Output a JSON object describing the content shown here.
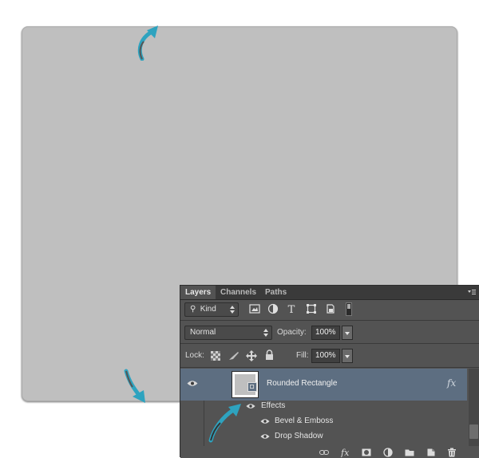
{
  "canvas": {
    "fill_color": "#bfbfbf"
  },
  "annotations": {
    "arrow_color": "#2ea3bf"
  },
  "panel": {
    "tabs": [
      {
        "label": "Layers",
        "active": true
      },
      {
        "label": "Channels",
        "active": false
      },
      {
        "label": "Paths",
        "active": false
      }
    ],
    "filter": {
      "label": "Kind"
    },
    "filter_icons": [
      "image-filter-icon",
      "adjustment-filter-icon",
      "type-filter-icon",
      "shape-filter-icon",
      "smart-object-filter-icon",
      "filter-toggle-icon"
    ],
    "blend_mode": "Normal",
    "opacity": {
      "label": "Opacity:",
      "value": "100%"
    },
    "lock": {
      "label": "Lock:",
      "icons": [
        "lock-transparent-icon",
        "lock-paint-icon",
        "lock-position-icon",
        "lock-all-icon"
      ]
    },
    "fill": {
      "label": "Fill:",
      "value": "100%"
    },
    "layer": {
      "name": "Rounded Rectangle",
      "fx": "fx",
      "selected_color": "#5d6e81"
    },
    "effects": {
      "label": "Effects",
      "items": [
        "Bevel & Emboss",
        "Drop Shadow"
      ]
    },
    "footer_icons": [
      "link-layers-icon",
      "fx-icon",
      "add-mask-icon",
      "adjustment-layer-icon",
      "new-group-icon",
      "new-layer-icon",
      "delete-layer-icon"
    ]
  }
}
